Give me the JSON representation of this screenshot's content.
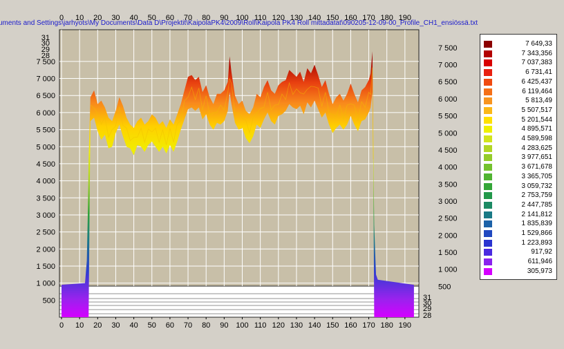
{
  "file_path": "uments and Settings\\jarhyots\\My Documents\\Data  D\\Projektit\\KaipolaPK4\\2009\\Roll\\Kaipola PK4 Roll mittadatat\\090205-12-09-00_Profile_CH1_ensiössä.txt",
  "colors": {
    "background": "#d4d0c8",
    "plot_area": "#c8bfa8",
    "grid": "#ffffff",
    "path_text": "#1a1acc",
    "base": "#d400ff"
  },
  "legend": [
    {
      "label": "7 649,33",
      "color": "#8b0000"
    },
    {
      "label": "7 343,356",
      "color": "#b30000"
    },
    {
      "label": "7 037,383",
      "color": "#d80000"
    },
    {
      "label": "6 731,41",
      "color": "#e82010"
    },
    {
      "label": "6 425,437",
      "color": "#f04a10"
    },
    {
      "label": "6 119,464",
      "color": "#f57018"
    },
    {
      "label": "5 813,49",
      "color": "#f89520"
    },
    {
      "label": "5 507,517",
      "color": "#fbb818"
    },
    {
      "label": "5 201,544",
      "color": "#ffe000"
    },
    {
      "label": "4 895,571",
      "color": "#eef000"
    },
    {
      "label": "4 589,598",
      "color": "#d2e41c"
    },
    {
      "label": "4 283,625",
      "color": "#b2d624"
    },
    {
      "label": "3 977,651",
      "color": "#94cc2a"
    },
    {
      "label": "3 671,678",
      "color": "#74c22e"
    },
    {
      "label": "3 365,705",
      "color": "#50b432"
    },
    {
      "label": "3 059,732",
      "color": "#34a638"
    },
    {
      "label": "2 753,759",
      "color": "#22984a"
    },
    {
      "label": "2 447,785",
      "color": "#1c8a64"
    },
    {
      "label": "2 141,812",
      "color": "#1a7a86"
    },
    {
      "label": "1 835,839",
      "color": "#1c62a8"
    },
    {
      "label": "1 529,866",
      "color": "#2048c0"
    },
    {
      "label": "1 223,893",
      "color": "#2a34d0"
    },
    {
      "label": "917,92",
      "color": "#4a2ae0"
    },
    {
      "label": "611,946",
      "color": "#8a22ee"
    },
    {
      "label": "305,973",
      "color": "#d400ff"
    }
  ],
  "chart_data": {
    "type": "area",
    "title": "",
    "xlabel": "",
    "ylabel": "",
    "xlim": [
      0,
      195
    ],
    "ylim": [
      0,
      7700
    ],
    "x_ticks": [
      0,
      10,
      20,
      30,
      40,
      50,
      60,
      70,
      80,
      90,
      100,
      110,
      120,
      130,
      140,
      150,
      160,
      170,
      180,
      190
    ],
    "y_ticks_left": [
      "500",
      "1 000",
      "1 500",
      "2 000",
      "2 500",
      "3 000",
      "3 500",
      "4 000",
      "4 500",
      "5 000",
      "5 500",
      "6 000",
      "6 500",
      "7 000",
      "7 500"
    ],
    "y_ticks_left_values": [
      500,
      1000,
      1500,
      2000,
      2500,
      3000,
      3500,
      4000,
      4500,
      5000,
      5500,
      6000,
      6500,
      7000,
      7500
    ],
    "y_ticks_right": [
      "500",
      "1 000",
      "1 500",
      "2 000",
      "2 500",
      "3 000",
      "3 500",
      "4 000",
      "4 500",
      "5 000",
      "5 500",
      "6 000",
      "6 500",
      "7 000",
      "7 500"
    ],
    "y_ticks_right_values": [
      500,
      1000,
      1500,
      2000,
      2500,
      3000,
      3500,
      4000,
      4500,
      5000,
      5500,
      6000,
      6500,
      7000,
      7500
    ],
    "depth_ticks_left": [
      "31",
      "30",
      "29",
      "28"
    ],
    "depth_ticks_right": [
      "31",
      "30",
      "29",
      "28"
    ],
    "profile": {
      "x": [
        0,
        13,
        14,
        14.5,
        15,
        16,
        18,
        20,
        22,
        24,
        26,
        28,
        30,
        32,
        34,
        36,
        38,
        40,
        42,
        44,
        46,
        48,
        50,
        52,
        54,
        56,
        58,
        60,
        62,
        64,
        66,
        68,
        70,
        72,
        74,
        76,
        78,
        80,
        82,
        84,
        86,
        88,
        90,
        92,
        93,
        94,
        96,
        98,
        100,
        102,
        104,
        106,
        108,
        110,
        112,
        114,
        116,
        118,
        120,
        122,
        124,
        126,
        128,
        130,
        132,
        134,
        136,
        138,
        140,
        142,
        144,
        146,
        148,
        150,
        152,
        154,
        156,
        158,
        160,
        162,
        164,
        166,
        168,
        170,
        171,
        172,
        172.5,
        173,
        174,
        175,
        195
      ],
      "high": [
        950,
        1000,
        1650,
        2900,
        4600,
        6450,
        6650,
        6250,
        6350,
        6150,
        5850,
        5750,
        6050,
        6450,
        6200,
        5850,
        5650,
        5550,
        5750,
        5850,
        5650,
        5750,
        5950,
        5850,
        5650,
        5750,
        5550,
        5800,
        5650,
        5950,
        6250,
        6650,
        7050,
        7100,
        6950,
        7050,
        6600,
        6800,
        6450,
        6250,
        6550,
        6550,
        6650,
        6900,
        7650,
        7200,
        6500,
        6250,
        6350,
        6050,
        5950,
        6150,
        6550,
        6450,
        6750,
        6950,
        6650,
        6550,
        6800,
        6900,
        6950,
        7250,
        7150,
        7050,
        7200,
        6900,
        7300,
        7150,
        7400,
        7100,
        6750,
        6950,
        6550,
        6250,
        6450,
        6550,
        6350,
        6550,
        6850,
        6550,
        6300,
        6650,
        6750,
        6950,
        7150,
        7800,
        5200,
        2700,
        1250,
        1100,
        950
      ],
      "low": [
        0,
        0,
        0,
        0,
        0,
        5750,
        5850,
        5450,
        5200,
        5350,
        4950,
        5000,
        5400,
        5650,
        5300,
        5000,
        4950,
        4750,
        5050,
        5000,
        4850,
        5050,
        5150,
        5000,
        4850,
        5000,
        4800,
        5050,
        4850,
        5150,
        5500,
        5800,
        6100,
        6150,
        6050,
        6150,
        5800,
        5950,
        5650,
        5500,
        5700,
        5650,
        5750,
        6050,
        6600,
        6250,
        5700,
        5500,
        5550,
        5250,
        5100,
        5300,
        5650,
        5550,
        5800,
        6000,
        5750,
        5650,
        5900,
        5950,
        6050,
        6250,
        6150,
        6100,
        6200,
        5950,
        6300,
        6150,
        6350,
        6100,
        5850,
        6000,
        5650,
        5400,
        5550,
        5650,
        5500,
        5650,
        5900,
        5650,
        5450,
        5750,
        5800,
        6000,
        6150,
        6600,
        4300,
        0,
        0,
        0,
        0
      ]
    }
  }
}
